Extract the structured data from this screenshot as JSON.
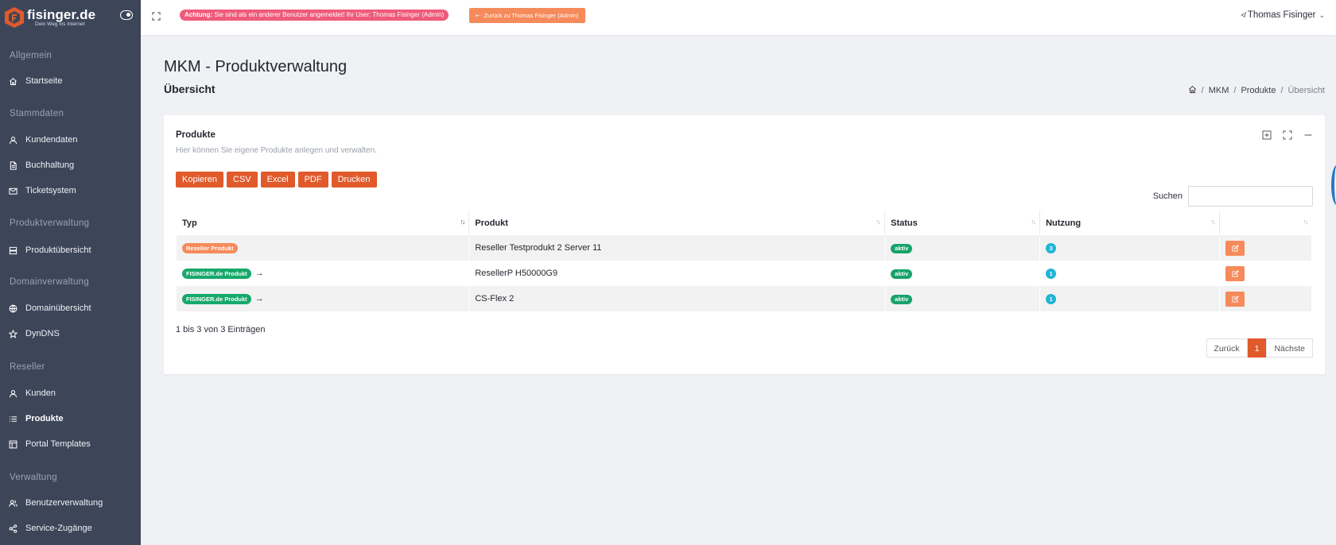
{
  "brand": {
    "name": "fisinger.de",
    "tagline": "Dein Weg ins Internet"
  },
  "sidebar": {
    "sections": [
      {
        "label": "Allgemein"
      },
      {
        "label": "Stammdaten"
      },
      {
        "label": "Produktverwaltung"
      },
      {
        "label": "Domainverwaltung"
      },
      {
        "label": "Reseller"
      },
      {
        "label": "Verwaltung"
      }
    ],
    "items": [
      {
        "label": "Startseite",
        "icon": "home-icon"
      },
      {
        "label": "Kundendaten",
        "icon": "user-icon"
      },
      {
        "label": "Buchhaltung",
        "icon": "file-icon"
      },
      {
        "label": "Ticketsystem",
        "icon": "mail-icon"
      },
      {
        "label": "Produktübersicht",
        "icon": "server-icon"
      },
      {
        "label": "Domainübersicht",
        "icon": "globe-icon"
      },
      {
        "label": "DynDNS",
        "icon": "star-icon"
      },
      {
        "label": "Kunden",
        "icon": "user-icon"
      },
      {
        "label": "Produkte",
        "icon": "list-icon",
        "active": true
      },
      {
        "label": "Portal Templates",
        "icon": "layout-icon"
      },
      {
        "label": "Benutzerverwaltung",
        "icon": "users-icon"
      },
      {
        "label": "Service-Zugänge",
        "icon": "share-icon"
      }
    ]
  },
  "topbar": {
    "alert_strong": "Achtung:",
    "alert_text": " Sie sind als ein anderer Benutzer angemeldet! Ihr User: Thomas Fisinger (Admin)",
    "back_button": "Zurück zu Thomas Fisinger (Admin)",
    "user_name": "Thomas Fisinger"
  },
  "page": {
    "title": "MKM - Produktverwaltung",
    "subtitle": "Übersicht",
    "breadcrumb": [
      "MKM",
      "Produkte",
      "Übersicht"
    ]
  },
  "card": {
    "title": "Produkte",
    "description": "Hier können Sie eigene Produkte anlegen und verwalten.",
    "export_buttons": [
      "Kopieren",
      "CSV",
      "Excel",
      "PDF",
      "Drucken"
    ],
    "search_label": "Suchen",
    "search_value": ""
  },
  "table": {
    "columns": [
      "Typ",
      "Produkt",
      "Status",
      "Nutzung",
      ""
    ],
    "rows": [
      {
        "type": "Reseller Produkt",
        "type_kind": "reseller",
        "has_arrow": false,
        "product": "Reseller Testprodukt 2 Server 11",
        "status": "aktiv",
        "usage": "3"
      },
      {
        "type": "FISINGER.de Produkt",
        "type_kind": "fis",
        "has_arrow": true,
        "product": "ResellerP H50000G9",
        "status": "aktiv",
        "usage": "1"
      },
      {
        "type": "FISINGER.de Produkt",
        "type_kind": "fis",
        "has_arrow": true,
        "product": "CS-Flex 2",
        "status": "aktiv",
        "usage": "1"
      }
    ],
    "info": "1 bis 3 von 3 Einträgen",
    "pager": {
      "prev": "Zurück",
      "current": "1",
      "next": "Nächste"
    }
  },
  "colors": {
    "sidebar_bg": "#3d4659",
    "accent": "#e05a2b",
    "reseller_badge": "#f58a5a",
    "fisinger_badge": "#17a86b",
    "status_active": "#16a36a",
    "usage_badge": "#1fb5d6",
    "alert": "#ef5a7a"
  }
}
